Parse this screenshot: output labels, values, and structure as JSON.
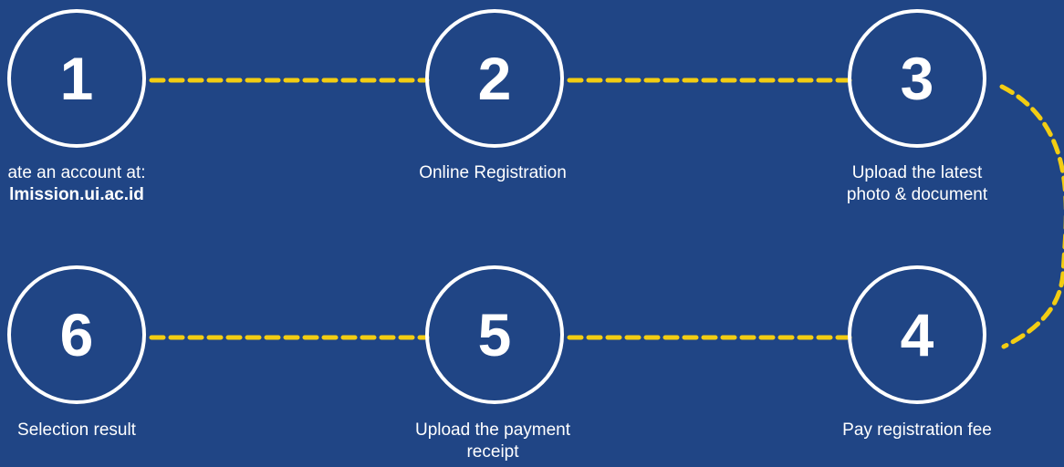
{
  "colors": {
    "background": "#204585",
    "connector": "#f3cd12",
    "circle": "#ffffff",
    "text": "#ffffff"
  },
  "steps": [
    {
      "number": "1",
      "line1": "ate an account at:",
      "line2": "lmission.ui.ac.id"
    },
    {
      "number": "2",
      "line1": "Online Registration",
      "line2": ""
    },
    {
      "number": "3",
      "line1": "Upload the latest",
      "line2": "photo & document"
    },
    {
      "number": "4",
      "line1": "Pay registration fee",
      "line2": ""
    },
    {
      "number": "5",
      "line1": "Upload the payment",
      "line2": "receipt"
    },
    {
      "number": "6",
      "line1": "Selection result",
      "line2": ""
    }
  ]
}
